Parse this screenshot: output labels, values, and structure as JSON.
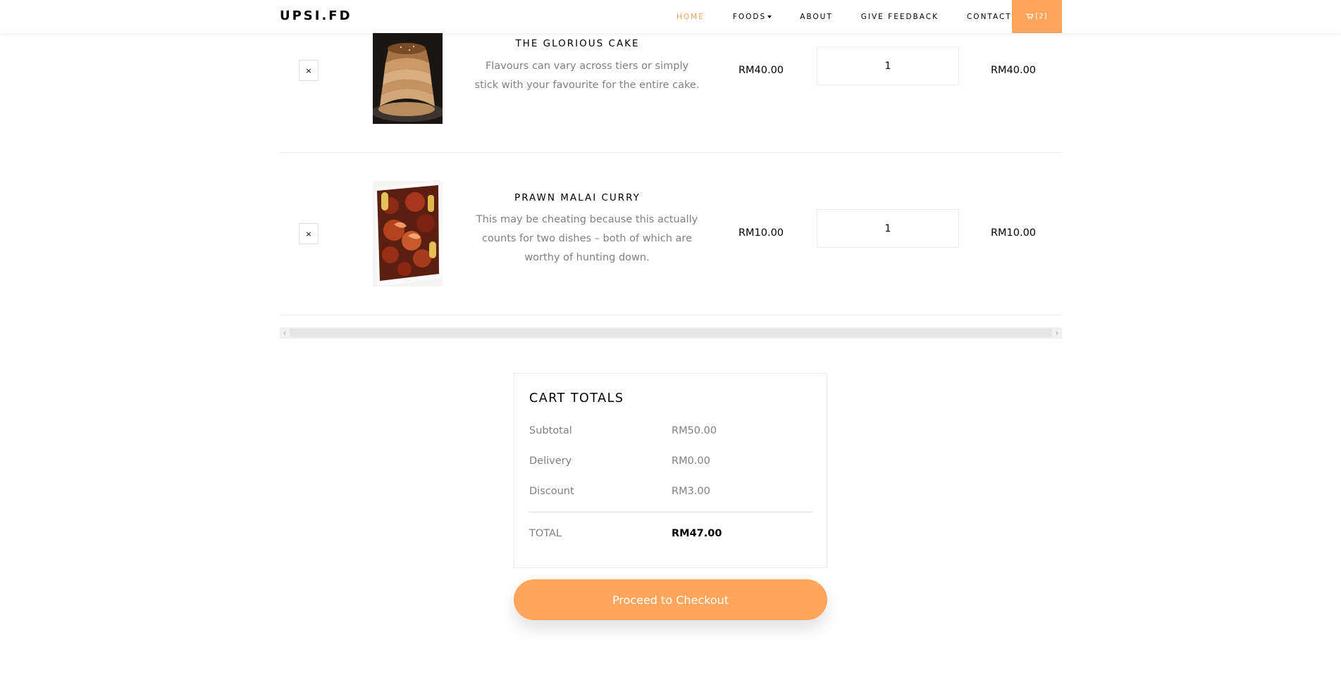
{
  "brand": "UPSI.FD",
  "nav": {
    "items": [
      {
        "label": "HOME",
        "active": true
      },
      {
        "label": "FOODS",
        "dropdown": true
      },
      {
        "label": "ABOUT"
      },
      {
        "label": "GIVE FEEDBACK"
      },
      {
        "label": "CONTACT"
      }
    ],
    "cart_label": "[2]",
    "cart_icon": "cart-icon"
  },
  "cart": {
    "items": [
      {
        "remove_label": "×",
        "name": "THE GLORIOUS CAKE",
        "description": "Flavours can vary across tiers or simply stick with your favourite for the entire cake.",
        "price": "RM40.00",
        "quantity": "1",
        "total": "RM40.00"
      },
      {
        "remove_label": "×",
        "name": "PRAWN MALAI CURRY",
        "description": "This may be cheating because this actually counts for two dishes – both of which are worthy of hunting down.",
        "price": "RM10.00",
        "quantity": "1",
        "total": "RM10.00"
      }
    ]
  },
  "scrollbar": {
    "left_arrow": "‹",
    "right_arrow": "›"
  },
  "totals": {
    "title": "CART TOTALS",
    "subtotal_label": "Subtotal",
    "subtotal_value": "RM50.00",
    "delivery_label": "Delivery",
    "delivery_value": "RM0.00",
    "discount_label": "Discount",
    "discount_value": "RM3.00",
    "total_label": "TOTAL",
    "total_value": "RM47.00"
  },
  "checkout_label": "Proceed to Checkout",
  "colors": {
    "accent": "#ffa55c",
    "active_nav": "#f89d5c",
    "muted_text": "#808080"
  }
}
